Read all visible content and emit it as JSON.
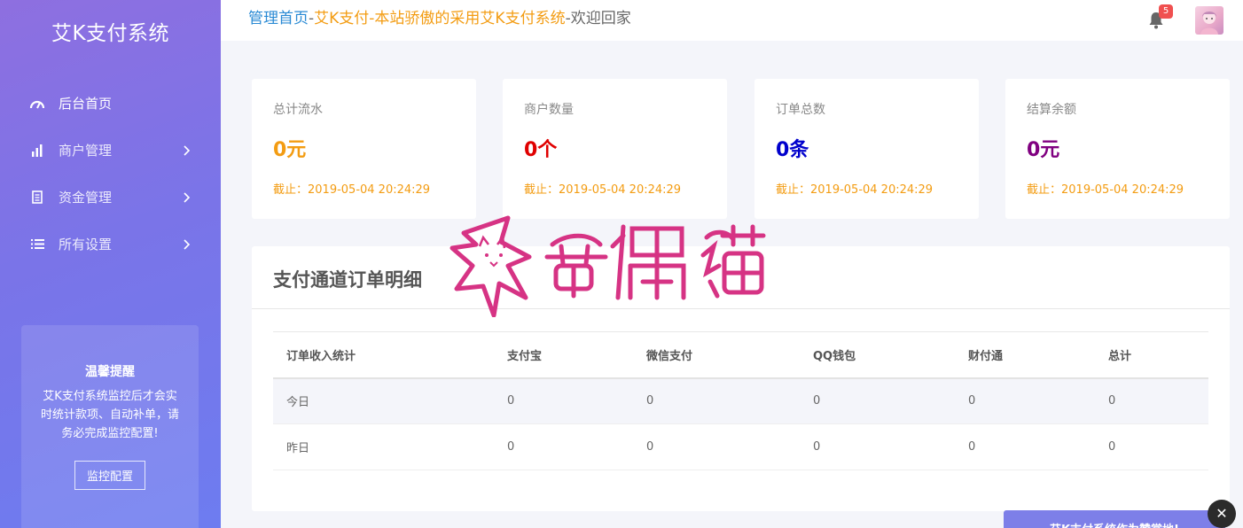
{
  "sidebar": {
    "brand": "艾K支付系统",
    "items": [
      {
        "label": "后台首页",
        "icon": "dashboard-icon",
        "active": true
      },
      {
        "label": "商户管理",
        "icon": "bar-chart-icon",
        "has_children": true
      },
      {
        "label": "资金管理",
        "icon": "document-icon",
        "has_children": true
      },
      {
        "label": "所有设置",
        "icon": "list-icon",
        "has_children": true
      }
    ],
    "tip": {
      "title": "温馨提醒",
      "text": "艾K支付系统监控后才会实时统计款项、自动补单，请务必完成监控配置!",
      "button": "监控配置"
    }
  },
  "header": {
    "breadcrumb": {
      "part1": "管理首页",
      "sep1": "-",
      "part2": "艾K支付-本站骄傲的采用艾K支付系统",
      "sep2": "-",
      "part3": "欢迎回家"
    },
    "notification_count": "5"
  },
  "stats": [
    {
      "label": "总计流水",
      "value": "0元",
      "color": "#f39c12",
      "time": "截止：2019-05-04 20:24:29"
    },
    {
      "label": "商户数量",
      "value": "0个",
      "color": "#e00000",
      "time": "截止：2019-05-04 20:24:29"
    },
    {
      "label": "订单总数",
      "value": "0条",
      "color": "#0000cc",
      "time": "截止：2019-05-04 20:24:29"
    },
    {
      "label": "结算余额",
      "value": "0元",
      "color": "#800080",
      "time": "截止：2019-05-04 20:24:29"
    }
  ],
  "orders": {
    "title": "支付通道订单明细",
    "columns": [
      "订单收入统计",
      "支付宝",
      "微信支付",
      "QQ钱包",
      "财付通",
      "总计"
    ],
    "rows": [
      [
        "今日",
        "0",
        "0",
        "0",
        "0",
        "0"
      ],
      [
        "昨日",
        "0",
        "0",
        "0",
        "0",
        "0"
      ]
    ]
  },
  "watermark": {
    "text": "奇偶猫"
  },
  "float_bar": {
    "text": "艾K支付系统作为赞赏地!"
  },
  "colors": {
    "accent": "#7a74e8",
    "link": "#2a8ad4",
    "orange": "#f39c12",
    "watermark": "#d63384"
  }
}
